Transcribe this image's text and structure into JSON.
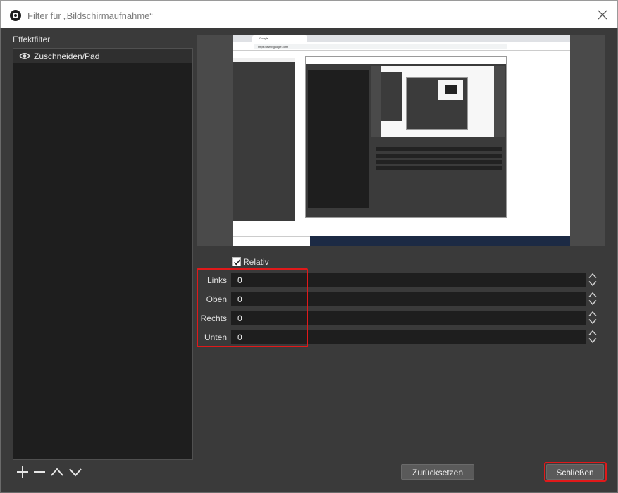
{
  "window": {
    "title": "Filter für „Bildschirmaufnahme“",
    "icon": "obs-logo-icon"
  },
  "left_panel": {
    "label": "Effektfilter",
    "filters": [
      {
        "name": "Zuschneiden/Pad",
        "visible": true
      }
    ],
    "tools": [
      "add-icon",
      "remove-icon",
      "move-up-icon",
      "move-down-icon"
    ]
  },
  "preview": {
    "browser_tab": "Google",
    "browser_url": "https://www.google.com"
  },
  "properties": {
    "relative": {
      "label": "Relativ",
      "checked": true
    },
    "fields": [
      {
        "label": "Links",
        "value": "0"
      },
      {
        "label": "Oben",
        "value": "0"
      },
      {
        "label": "Rechts",
        "value": "0"
      },
      {
        "label": "Unten",
        "value": "0"
      }
    ]
  },
  "buttons": {
    "reset": "Zurücksetzen",
    "close": "Schließen"
  },
  "colors": {
    "background": "#3a3a3a",
    "list_bg": "#1e1e1e",
    "highlight": "#e0191a"
  }
}
